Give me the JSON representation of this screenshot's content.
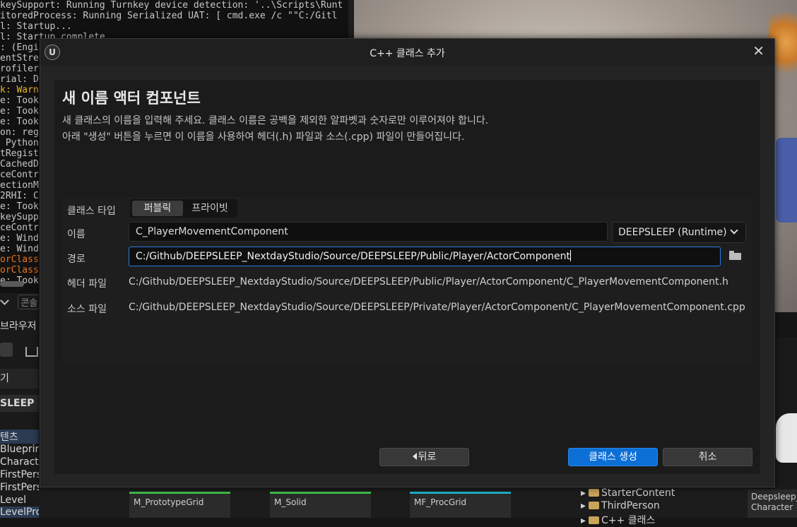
{
  "background": {
    "log_lines": [
      {
        "text": "keySupport: Running Turnkey device detection: '..\\Scripts\\Runt",
        "style": "normal"
      },
      {
        "text": "itoredProcess: Running Serialized UAT: [ cmd.exe /c \"\"C:/Gitl",
        "style": "normal"
      },
      {
        "text": "l: Startup...",
        "style": "normal"
      },
      {
        "text": "l: Startup complete.",
        "style": "normal"
      },
      {
        "text": ": (Engi",
        "style": "normal"
      },
      {
        "text": "entStre",
        "style": "normal"
      },
      {
        "text": "rofiler",
        "style": "normal"
      },
      {
        "text": "rial: D",
        "style": "normal"
      },
      {
        "text": "k: Warn",
        "style": "warn"
      },
      {
        "text": "e: Took",
        "style": "normal"
      },
      {
        "text": "e: Took",
        "style": "normal"
      },
      {
        "text": "e: Took",
        "style": "normal"
      },
      {
        "text": "on: reg",
        "style": "normal"
      },
      {
        "text": " Python",
        "style": "normal"
      },
      {
        "text": "tRegist",
        "style": "normal"
      },
      {
        "text": "CachedD",
        "style": "normal"
      },
      {
        "text": "ceContr",
        "style": "normal"
      },
      {
        "text": "ectionM",
        "style": "normal"
      },
      {
        "text": "2RHI: C",
        "style": "normal"
      },
      {
        "text": "e: Took",
        "style": "normal"
      },
      {
        "text": "keySupp",
        "style": "normal"
      },
      {
        "text": "ceContr",
        "style": "normal"
      },
      {
        "text": "e: Wind",
        "style": "normal"
      },
      {
        "text": "e: Wind",
        "style": "normal"
      },
      {
        "text": "orClass",
        "style": "err"
      },
      {
        "text": "orClass",
        "style": "err"
      },
      {
        "text": "e: Took",
        "style": "normal"
      }
    ],
    "left_panel": {
      "console_placeholder": "콘솔",
      "browser_label": "브라우저",
      "back_label": "기",
      "project_label": "SLEEP",
      "items": [
        "텐츠",
        "Blueprint",
        "Characte",
        "FirstPers",
        "FirstPerson",
        "Level",
        "LevelPrototyping"
      ]
    },
    "thumbnails": [
      {
        "label": "M_PrototypeGrid",
        "color": "#3fbf4a"
      },
      {
        "label": "M_Solid",
        "color": "#3fbf4a"
      },
      {
        "label": "MF_ProcGrid",
        "color": "#1fb3c8"
      }
    ],
    "folders": [
      "StarterContent",
      "ThirdPerson",
      "C++ 클래스"
    ],
    "right_card": [
      "Deepsleep_",
      "Character"
    ]
  },
  "dialog": {
    "title": "C++ 클래스 추가",
    "logo": "U",
    "heading": "새 이름 액터 컴포넌트",
    "description_1": "새 클래스의 이름을 입력해 주세요. 클래스 이름은 공백을 제외한 알파벳과 숫자로만 이루어져야 합니다.",
    "description_2": "아래 \"생성\" 버튼을 누르면 이 이름을 사용하여 헤더(.h) 파일과 소스(.cpp) 파일이 만들어집니다.",
    "class_type_label": "클래스 타입",
    "class_type_options": [
      "퍼블릭",
      "프라이빗"
    ],
    "class_type_selected": "퍼블릭",
    "name_label": "이름",
    "name_value": "C_PlayerMovementComponent",
    "module_value": "DEEPSLEEP (Runtime)",
    "path_label": "경로",
    "path_value": "C:/Github/DEEPSLEEP_NextdayStudio/Source/DEEPSLEEP/Public/Player/ActorComponent",
    "header_label": "헤더 파일",
    "header_value": "C:/Github/DEEPSLEEP_NextdayStudio/Source/DEEPSLEEP/Public/Player/ActorComponent/C_PlayerMovementComponent.h",
    "source_label": "소스 파일",
    "source_value": "C:/Github/DEEPSLEEP_NextdayStudio/Source/DEEPSLEEP/Private/Player/ActorComponent/C_PlayerMovementComponent.cpp",
    "back_button": "뒤로",
    "create_button": "클래스 생성",
    "cancel_button": "취소"
  },
  "colors": {
    "accent": "#0b6fd6",
    "focus_border": "#2a7be0",
    "warn": "#e8b22b",
    "error": "#e8741e"
  }
}
